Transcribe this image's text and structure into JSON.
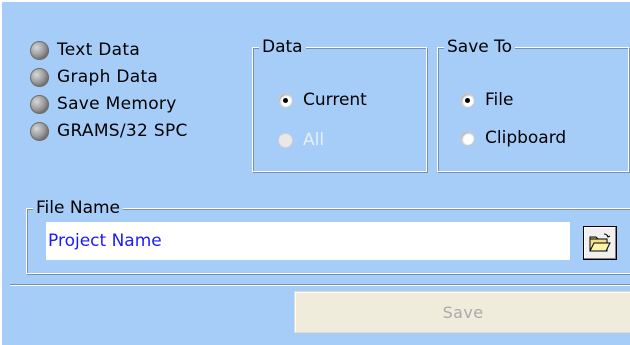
{
  "export_types": [
    {
      "label": "Text Data",
      "icon": "led-indicator-icon"
    },
    {
      "label": "Graph Data",
      "icon": "led-indicator-icon"
    },
    {
      "label": "Save Memory",
      "icon": "led-indicator-icon"
    },
    {
      "label": "GRAMS/32 SPC",
      "icon": "led-indicator-icon"
    }
  ],
  "data_group": {
    "title": "Data",
    "options": [
      {
        "label": "Current",
        "checked": true,
        "enabled": true
      },
      {
        "label": "All",
        "checked": false,
        "enabled": false
      }
    ]
  },
  "save_to_group": {
    "title": "Save To",
    "options": [
      {
        "label": "File",
        "checked": true,
        "enabled": true
      },
      {
        "label": "Clipboard",
        "checked": false,
        "enabled": true
      }
    ]
  },
  "file_name": {
    "title": "File Name",
    "value": "Project Name",
    "browse_icon": "open-folder-icon"
  },
  "actions": {
    "save_label": "Save",
    "save_enabled": false
  },
  "colors": {
    "background": "#a6ccf8",
    "file_text": "#1a1aff",
    "disabled_text": "#a9a9a9"
  }
}
